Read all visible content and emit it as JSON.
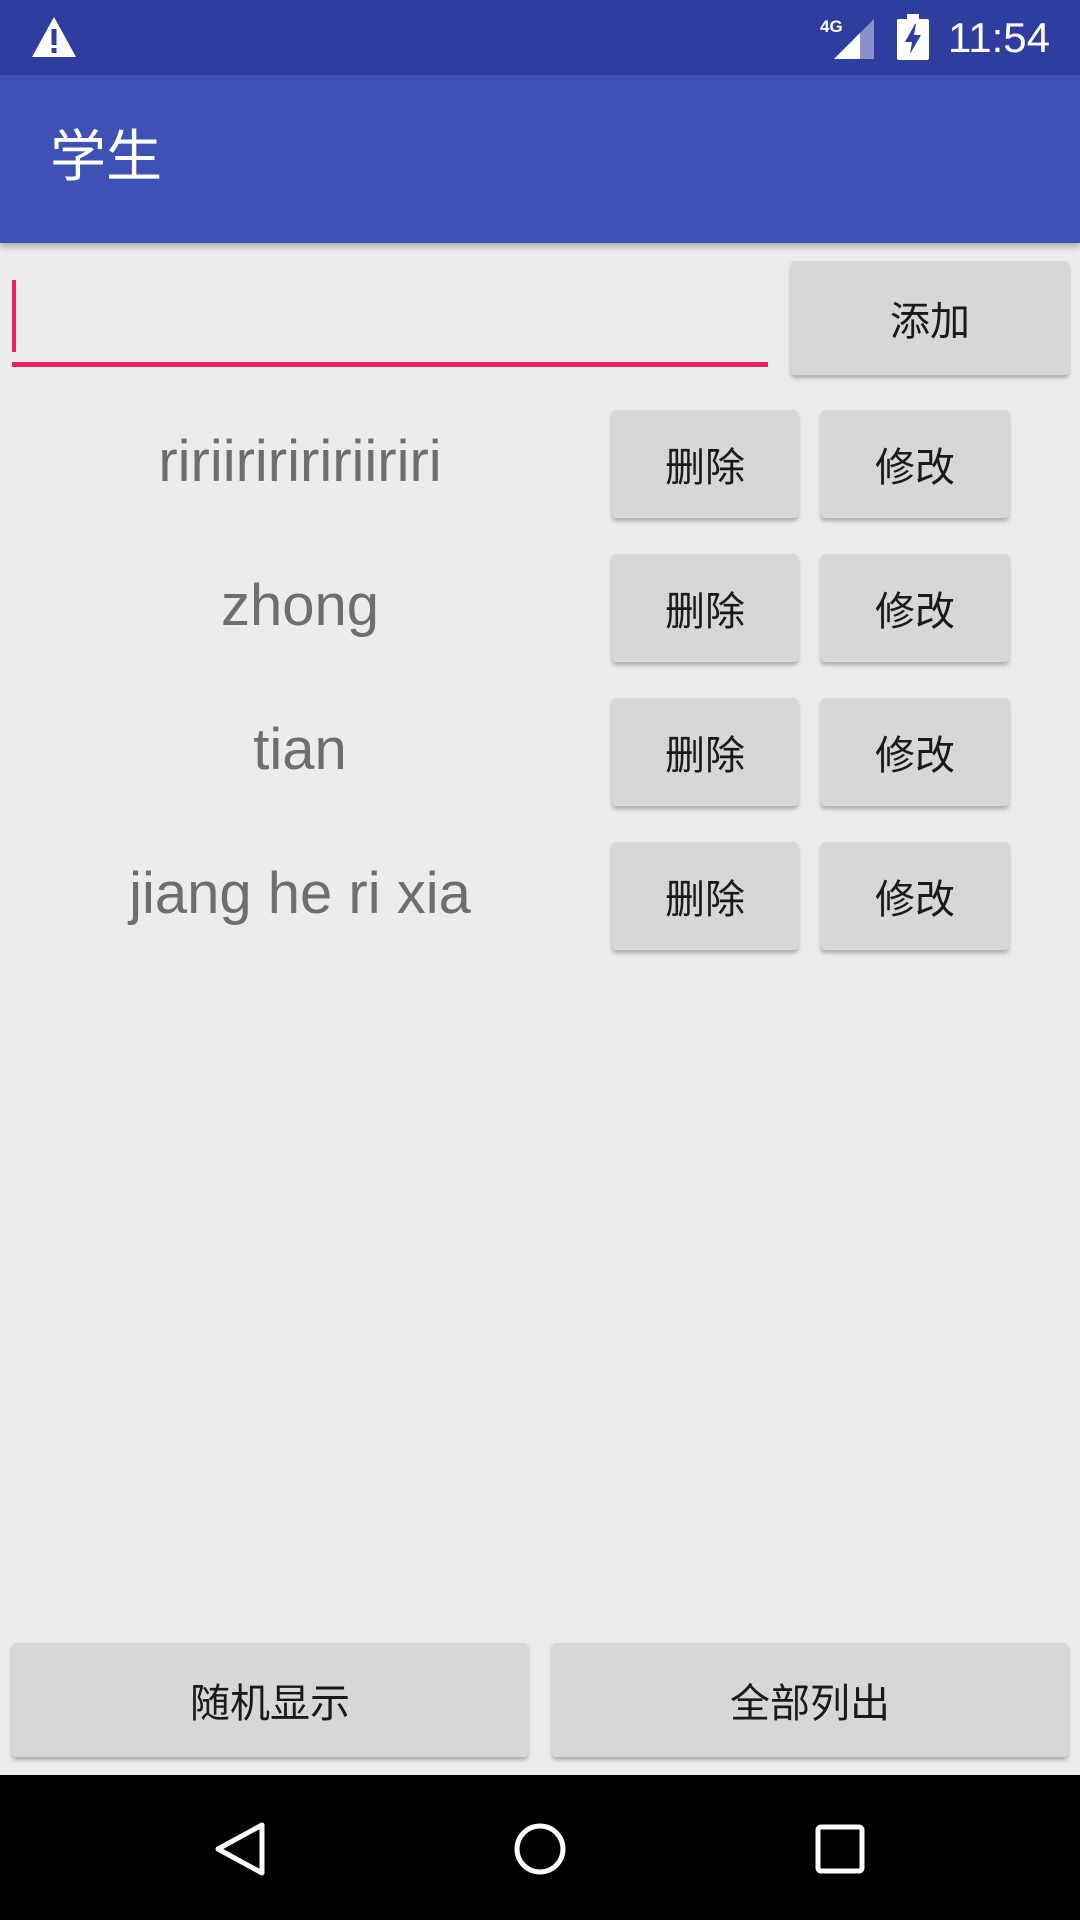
{
  "status_bar": {
    "time": "11:54",
    "network": "4G",
    "icons": [
      "warning-icon",
      "signal-icon",
      "battery-charging-icon"
    ]
  },
  "app_bar": {
    "title": "学生"
  },
  "add_form": {
    "input_value": "",
    "add_label": "添加"
  },
  "students": [
    {
      "name": "ririiririririiriri",
      "delete_label": "删除",
      "edit_label": "修改"
    },
    {
      "name": "zhong",
      "delete_label": "删除",
      "edit_label": "修改"
    },
    {
      "name": "tian",
      "delete_label": "删除",
      "edit_label": "修改"
    },
    {
      "name": "jiang he ri xia",
      "delete_label": "删除",
      "edit_label": "修改"
    }
  ],
  "bottom_actions": {
    "random_label": "随机显示",
    "list_all_label": "全部列出"
  },
  "nav_bar": {
    "icons": [
      "back-icon",
      "home-icon",
      "recents-icon"
    ]
  },
  "colors": {
    "status_bar": "#2f3e9e",
    "app_bar": "#3f51b5",
    "accent": "#e91e63",
    "background": "#ececec",
    "button": "#d6d7d7"
  }
}
